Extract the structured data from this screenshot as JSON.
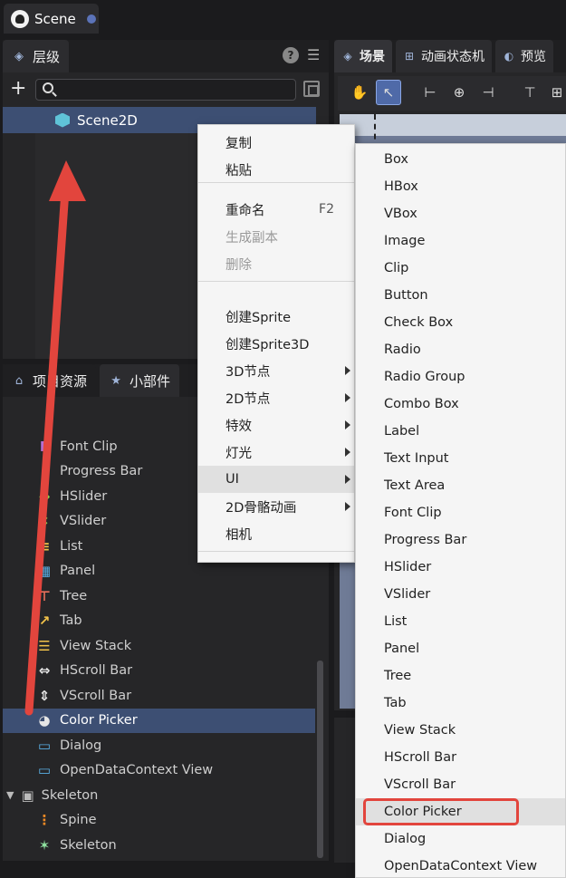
{
  "window": {
    "tab_title": "Scene"
  },
  "hierarchy": {
    "tab_label": "层级",
    "help_label": "?",
    "menu_label": "☰",
    "add_label": "+",
    "search_placeholder": "",
    "root_node": "Scene2D"
  },
  "scene_panel": {
    "tabs": [
      {
        "label": "场景"
      },
      {
        "label": "动画状态机"
      },
      {
        "label": "预览"
      }
    ]
  },
  "widgets_panel": {
    "tabs": [
      {
        "label": "项目资源"
      },
      {
        "label": "小部件"
      }
    ],
    "items": [
      {
        "label": "Font Clip",
        "color": "#b56fd6",
        "glyph": "F"
      },
      {
        "label": "Progress Bar",
        "color": "#cfcfcf",
        "glyph": "•"
      },
      {
        "label": "HSlider",
        "color": "#8bd64b",
        "glyph": "↔"
      },
      {
        "label": "VSlider",
        "color": "#8bd64b",
        "glyph": "↕"
      },
      {
        "label": "List",
        "color": "#f2c34a",
        "glyph": "≡"
      },
      {
        "label": "Panel",
        "color": "#5ab0e6",
        "glyph": "▦"
      },
      {
        "label": "Tree",
        "color": "#e8705a",
        "glyph": "⊤"
      },
      {
        "label": "Tab",
        "color": "#f2c34a",
        "glyph": "↗"
      },
      {
        "label": "View Stack",
        "color": "#f2c34a",
        "glyph": "☰"
      },
      {
        "label": "HScroll Bar",
        "color": "#e6e6e6",
        "glyph": "⇔"
      },
      {
        "label": "VScroll Bar",
        "color": "#e6e6e6",
        "glyph": "⇕"
      },
      {
        "label": "Color Picker",
        "color": "#e6e6e6",
        "glyph": "◕"
      },
      {
        "label": "Dialog",
        "color": "#5ab0e6",
        "glyph": "▭"
      },
      {
        "label": "OpenDataContext View",
        "color": "#5ab0e6",
        "glyph": "▭"
      }
    ],
    "group": {
      "label": "Skeleton"
    },
    "group_items": [
      {
        "label": "Spine",
        "color": "#f08a24",
        "glyph": "⋮"
      },
      {
        "label": "Skeleton",
        "color": "#8fe3a0",
        "glyph": "✶"
      }
    ]
  },
  "context_menu": {
    "items": [
      {
        "label": "复制",
        "shortcut": "",
        "disabled": false,
        "submenu": false
      },
      {
        "label": "粘贴",
        "shortcut": "",
        "disabled": false,
        "submenu": false
      },
      {
        "label": "重命名",
        "shortcut": "F2",
        "disabled": false,
        "submenu": false
      },
      {
        "label": "生成副本",
        "shortcut": "",
        "disabled": true,
        "submenu": false
      },
      {
        "label": "删除",
        "shortcut": "",
        "disabled": true,
        "submenu": false
      },
      {
        "label": "创建Sprite",
        "shortcut": "",
        "disabled": false,
        "submenu": false
      },
      {
        "label": "创建Sprite3D",
        "shortcut": "",
        "disabled": false,
        "submenu": false
      },
      {
        "label": "3D节点",
        "shortcut": "",
        "disabled": false,
        "submenu": true
      },
      {
        "label": "2D节点",
        "shortcut": "",
        "disabled": false,
        "submenu": true
      },
      {
        "label": "特效",
        "shortcut": "",
        "disabled": false,
        "submenu": true
      },
      {
        "label": "灯光",
        "shortcut": "",
        "disabled": false,
        "submenu": true
      },
      {
        "label": "UI",
        "shortcut": "",
        "disabled": false,
        "submenu": true,
        "highlighted": true
      },
      {
        "label": "2D骨骼动画",
        "shortcut": "",
        "disabled": false,
        "submenu": true
      },
      {
        "label": "相机",
        "shortcut": "",
        "disabled": false,
        "submenu": false
      }
    ]
  },
  "ui_submenu": {
    "items": [
      "Box",
      "HBox",
      "VBox",
      "Image",
      "Clip",
      "Button",
      "Check Box",
      "Radio",
      "Radio Group",
      "Combo Box",
      "Label",
      "Text Input",
      "Text Area",
      "Font Clip",
      "Progress Bar",
      "HSlider",
      "VSlider",
      "List",
      "Panel",
      "Tree",
      "Tab",
      "View Stack",
      "HScroll Bar",
      "VScroll Bar",
      "Color Picker",
      "Dialog",
      "OpenDataContext View"
    ],
    "highlighted": "Color Picker"
  },
  "colors": {
    "accent": "#3d4f73",
    "annotation": "#e2453d"
  }
}
